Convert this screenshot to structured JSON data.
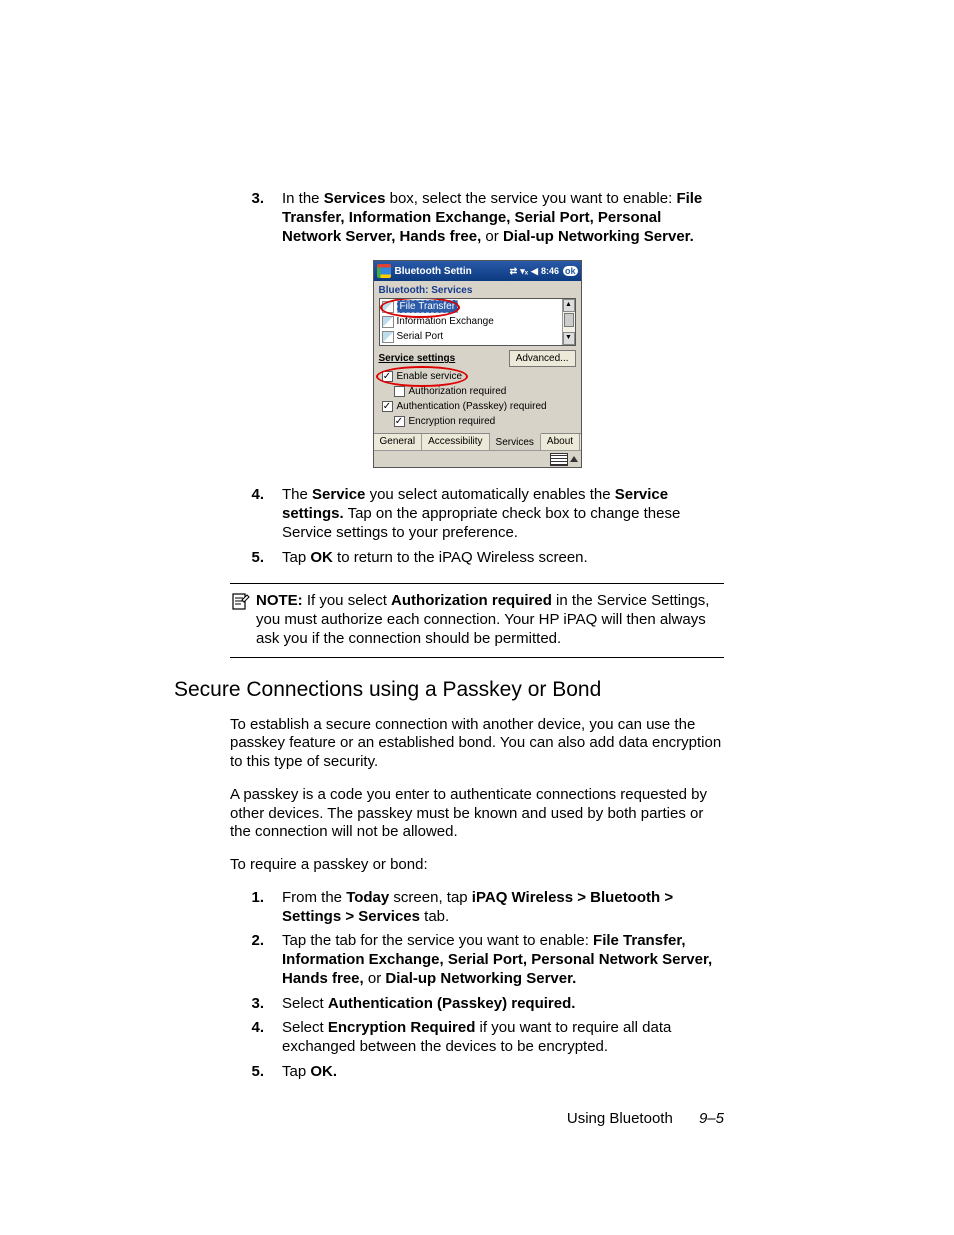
{
  "steps_a": {
    "n3": "3.",
    "t3a": "In the ",
    "t3b": "Services",
    "t3c": " box, select the service you want to enable: ",
    "t3d": "File Transfer, Information Exchange, Serial Port, Personal Network Server, Hands free,",
    "t3e": " or ",
    "t3f": "Dial-up Networking Server."
  },
  "device": {
    "title": "Bluetooth Settin",
    "time": "8:46",
    "ok": "ok",
    "section": "Bluetooth: Services",
    "items": [
      "File Transfer",
      "Information Exchange",
      "Serial Port"
    ],
    "svc_head": "Service settings",
    "advanced": "Advanced...",
    "chk": {
      "enable": "Enable service",
      "auth": "Authorization required",
      "passkey": "Authentication (Passkey) required",
      "enc": "Encryption required"
    },
    "tabs": [
      "General",
      "Accessibility",
      "Services",
      "About"
    ],
    "states": {
      "enable": true,
      "auth": false,
      "passkey": true,
      "enc": true
    }
  },
  "steps_b": {
    "n4": "4.",
    "t4a": "The ",
    "t4b": "Service",
    "t4c": " you select automatically enables the ",
    "t4d": "Service settings.",
    "t4e": " Tap on the appropriate check box to change these Service settings to your preference.",
    "n5": "5.",
    "t5a": "Tap ",
    "t5b": "OK",
    "t5c": " to return to the iPAQ Wireless screen."
  },
  "note": {
    "label": "NOTE:",
    "t1": " If you select ",
    "t2": "Authorization required",
    "t3": " in the Service Settings, you must authorize each connection. Your HP iPAQ will then always ask you if the connection should be permitted."
  },
  "h2": "Secure Connections using a Passkey or Bond",
  "paras": {
    "p1": "To establish a secure connection with another device, you can use the passkey feature or an established bond. You can also add data encryption to this type of security.",
    "p2": "A passkey is a code you enter to authenticate connections requested by other devices. The passkey must be known and used by both parties or the connection will not be allowed.",
    "p3": "To require a passkey or bond:"
  },
  "steps_c": {
    "n1": "1.",
    "t1a": "From the ",
    "t1b": "Today",
    "t1c": " screen, tap ",
    "t1d": "iPAQ Wireless > Bluetooth > Settings > Services",
    "t1e": " tab.",
    "n2": "2.",
    "t2a": "Tap the tab for the service you want to enable: ",
    "t2b": "File Transfer, Information Exchange, Serial Port, Personal Network Server, Hands free,",
    "t2c": " or ",
    "t2d": "Dial-up Networking Server.",
    "n3": "3.",
    "t3a": "Select ",
    "t3b": "Authentication (Passkey) required.",
    "n4": "4.",
    "t4a": "Select ",
    "t4b": "Encryption Required",
    "t4c": " if you want to require all data exchanged between the devices to be encrypted.",
    "n5": "5.",
    "t5a": "Tap ",
    "t5b": "OK."
  },
  "footer": {
    "chapter": "Using Bluetooth",
    "page": "9–5"
  }
}
